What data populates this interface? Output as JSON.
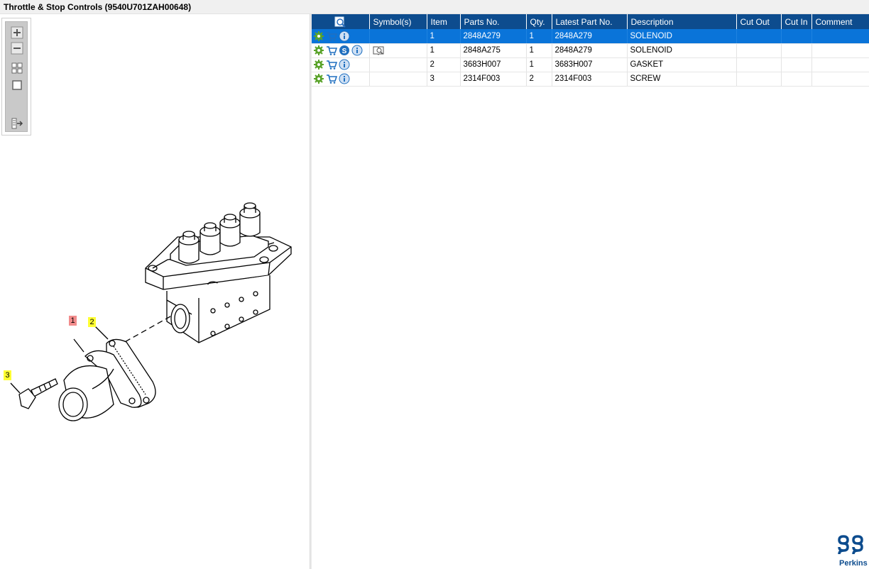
{
  "window": {
    "title": "Throttle & Stop Controls (9540U701ZAH00648)"
  },
  "toolbox": {
    "tools": [
      {
        "name": "zoom-in-icon"
      },
      {
        "name": "zoom-out-icon"
      },
      {
        "name": "fit-all-icon"
      },
      {
        "name": "fit-window-icon"
      },
      {
        "name": "export-icon"
      }
    ]
  },
  "drawing": {
    "callouts": [
      {
        "label": "1",
        "color": "#f28c8c"
      },
      {
        "label": "2",
        "color": "#ffff33"
      },
      {
        "label": "3",
        "color": "#ffff33"
      }
    ]
  },
  "table": {
    "columns": [
      "Symbol(s)",
      "Item",
      "Parts No.",
      "Qty.",
      "Latest Part No.",
      "Description",
      "Cut Out",
      "Cut In",
      "Comment"
    ],
    "rows": [
      {
        "item": "1",
        "parts_no": "2848A279",
        "qty": "1",
        "latest_part_no": "2848A279",
        "description": "SOLENOID",
        "cut_out": "",
        "cut_in": "",
        "comment": "",
        "selected": true,
        "icons": [
          "gear-icon",
          "cart-icon",
          "info-icon"
        ],
        "symbols": []
      },
      {
        "item": "1",
        "parts_no": "2848A275",
        "qty": "1",
        "latest_part_no": "2848A279",
        "description": "SOLENOID",
        "cut_out": "",
        "cut_in": "",
        "comment": "",
        "selected": false,
        "icons": [
          "gear-icon",
          "cart-icon",
          "superseded-icon",
          "info-icon"
        ],
        "symbols": [
          "book-icon"
        ]
      },
      {
        "item": "2",
        "parts_no": "3683H007",
        "qty": "1",
        "latest_part_no": "3683H007",
        "description": "GASKET",
        "cut_out": "",
        "cut_in": "",
        "comment": "",
        "selected": false,
        "icons": [
          "gear-icon",
          "cart-icon",
          "info-icon"
        ],
        "symbols": []
      },
      {
        "item": "3",
        "parts_no": "2314F003",
        "qty": "2",
        "latest_part_no": "2314F003",
        "description": "SCREW",
        "cut_out": "",
        "cut_in": "",
        "comment": "",
        "selected": false,
        "icons": [
          "gear-icon",
          "cart-icon",
          "info-icon"
        ],
        "symbols": []
      }
    ]
  },
  "brand": {
    "logo_text": "Perkins",
    "color": "#0d4c8e"
  },
  "colors": {
    "header": "#0d4c8e",
    "selected_row": "#0a74d9",
    "callout_yellow": "#ffff33",
    "callout_red": "#f28c8c"
  }
}
